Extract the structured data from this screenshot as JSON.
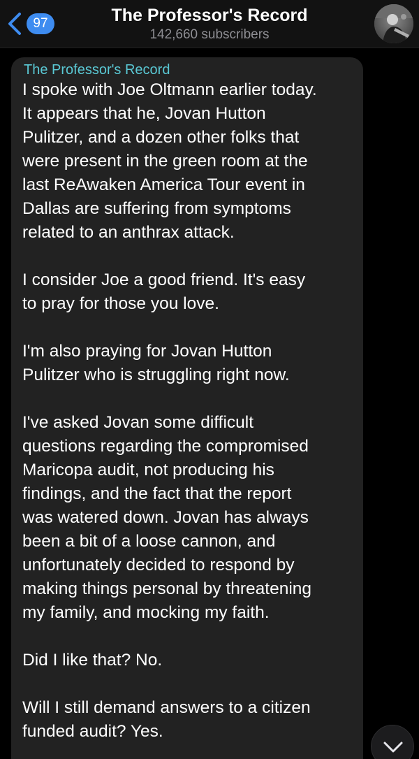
{
  "header": {
    "back_count": "97",
    "title": "The Professor's Record",
    "subscribers": "142,660 subscribers",
    "accent_color": "#3e8cf0"
  },
  "message": {
    "author": "The Professor's Record",
    "author_color": "#5ac8d4",
    "paragraphs": [
      "I spoke with Joe Oltmann earlier today.\nIt appears that he, Jovan Hutton\nPulitzer, and a dozen other folks that\nwere present in the green room at the\nlast ReAwaken America Tour event in\nDallas are suffering from symptoms\nrelated to an anthrax attack.",
      "I consider Joe a good friend.  It's easy\nto pray for those you love.",
      "I'm also praying for Jovan Hutton\nPulitzer who is struggling right now.",
      "I've asked Jovan some difficult\nquestions regarding the compromised\nMaricopa audit, not producing his\nfindings, and the fact that the report\nwas watered down.  Jovan has always\nbeen a bit of a loose cannon, and\nunfortunately decided to respond by\nmaking things personal by threatening\nmy family, and mocking my faith.",
      "Did I like that?  No.",
      "Will I still demand answers to a citizen\nfunded audit?  Yes."
    ]
  },
  "icons": {
    "back": "chevron-left-icon",
    "scroll": "chevron-down-icon"
  }
}
